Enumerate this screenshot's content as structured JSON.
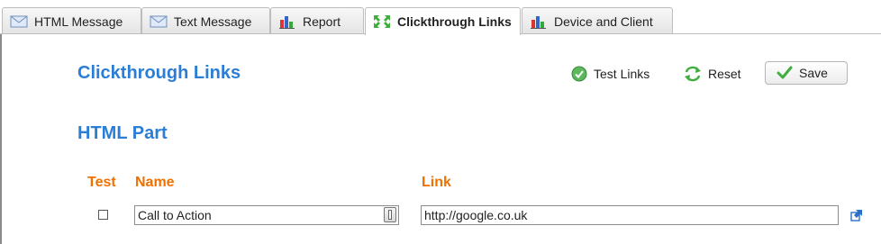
{
  "tabs": [
    {
      "label": "HTML Message",
      "icon": "envelope-icon",
      "active": false
    },
    {
      "label": "Text Message",
      "icon": "envelope-icon",
      "active": false
    },
    {
      "label": "Report",
      "icon": "bar-chart-icon",
      "active": false
    },
    {
      "label": "Clickthrough Links",
      "icon": "expand-arrows-icon",
      "active": true
    },
    {
      "label": "Device and Client",
      "icon": "bar-chart-icon",
      "active": false
    }
  ],
  "page": {
    "title": "Clickthrough Links",
    "section_title": "HTML Part"
  },
  "toolbar": {
    "test_links_label": "Test Links",
    "reset_label": "Reset",
    "save_label": "Save"
  },
  "table": {
    "columns": {
      "test": "Test",
      "name": "Name",
      "link": "Link"
    },
    "rows": [
      {
        "test_checked": false,
        "name": "Call to Action",
        "link": "http://google.co.uk"
      }
    ]
  },
  "colors": {
    "heading": "#2b7ed6",
    "column_header": "#f07000",
    "check_green": "#3fae3f"
  }
}
